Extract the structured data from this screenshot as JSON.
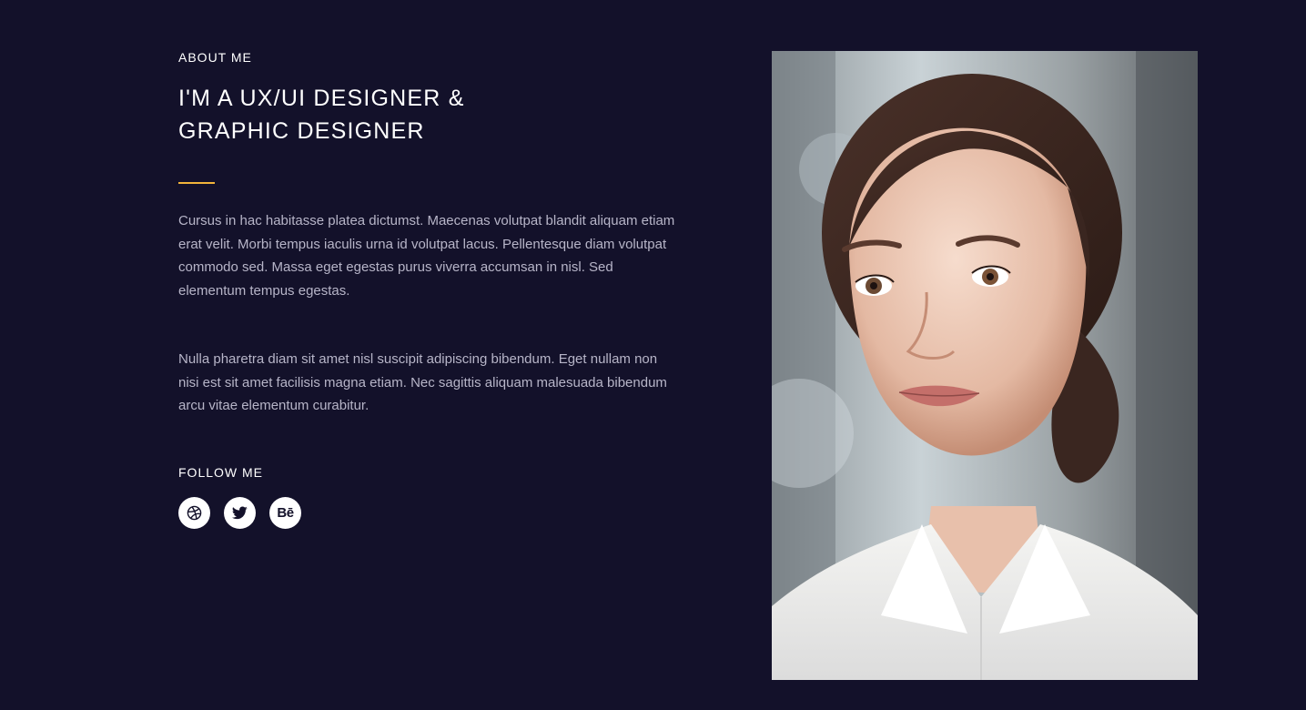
{
  "about": {
    "eyebrow": "ABOUT ME",
    "title": "I'M A UX/UI DESIGNER & GRAPHIC DESIGNER",
    "accent_color": "#f2b43b",
    "paragraph_1": "Cursus in hac habitasse platea dictumst. Maecenas volutpat blandit aliquam etiam erat velit. Morbi tempus iaculis urna id volutpat lacus. Pellentesque diam volutpat commodo sed. Massa eget egestas purus viverra accumsan in nisl. Sed elementum tempus egestas.",
    "paragraph_2": "Nulla pharetra diam sit amet nisl suscipit adipiscing bibendum. Eget nullam non nisi est sit amet facilisis magna etiam. Nec sagittis aliquam malesuada bibendum arcu vitae elementum curabitur."
  },
  "follow": {
    "label": "FOLLOW ME",
    "socials": [
      {
        "icon": "dribbble-icon"
      },
      {
        "icon": "twitter-icon"
      },
      {
        "icon": "behance-icon",
        "text": "Bē"
      }
    ]
  },
  "colors": {
    "background": "#13112a",
    "text": "#ffffff",
    "body_text": "#b7b5c8"
  },
  "photo": {
    "subject": "portrait-photo"
  }
}
